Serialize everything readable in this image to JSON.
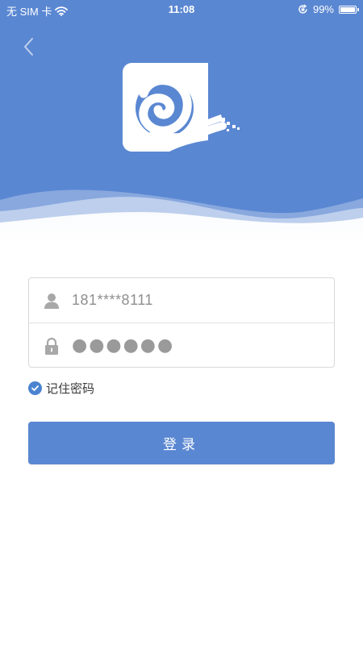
{
  "status_bar": {
    "carrier": "无 SIM 卡",
    "time": "11:08",
    "battery": "99%",
    "battery_level": 0.99
  },
  "icons": {
    "back": "chevron-left-icon",
    "wifi": "wifi-icon",
    "rotation_lock": "rotation-lock-icon",
    "battery": "battery-icon",
    "user": "user-icon",
    "lock": "lock-icon",
    "check": "check-icon"
  },
  "login_form": {
    "username_value": "181****8111",
    "password_value": "●●●●●●"
  },
  "remember_password": {
    "label": "记住密码",
    "checked": true
  },
  "login_button": {
    "label": "登录"
  },
  "colors": {
    "primary": "#5a87d2",
    "checkbox": "#4a83d0"
  }
}
